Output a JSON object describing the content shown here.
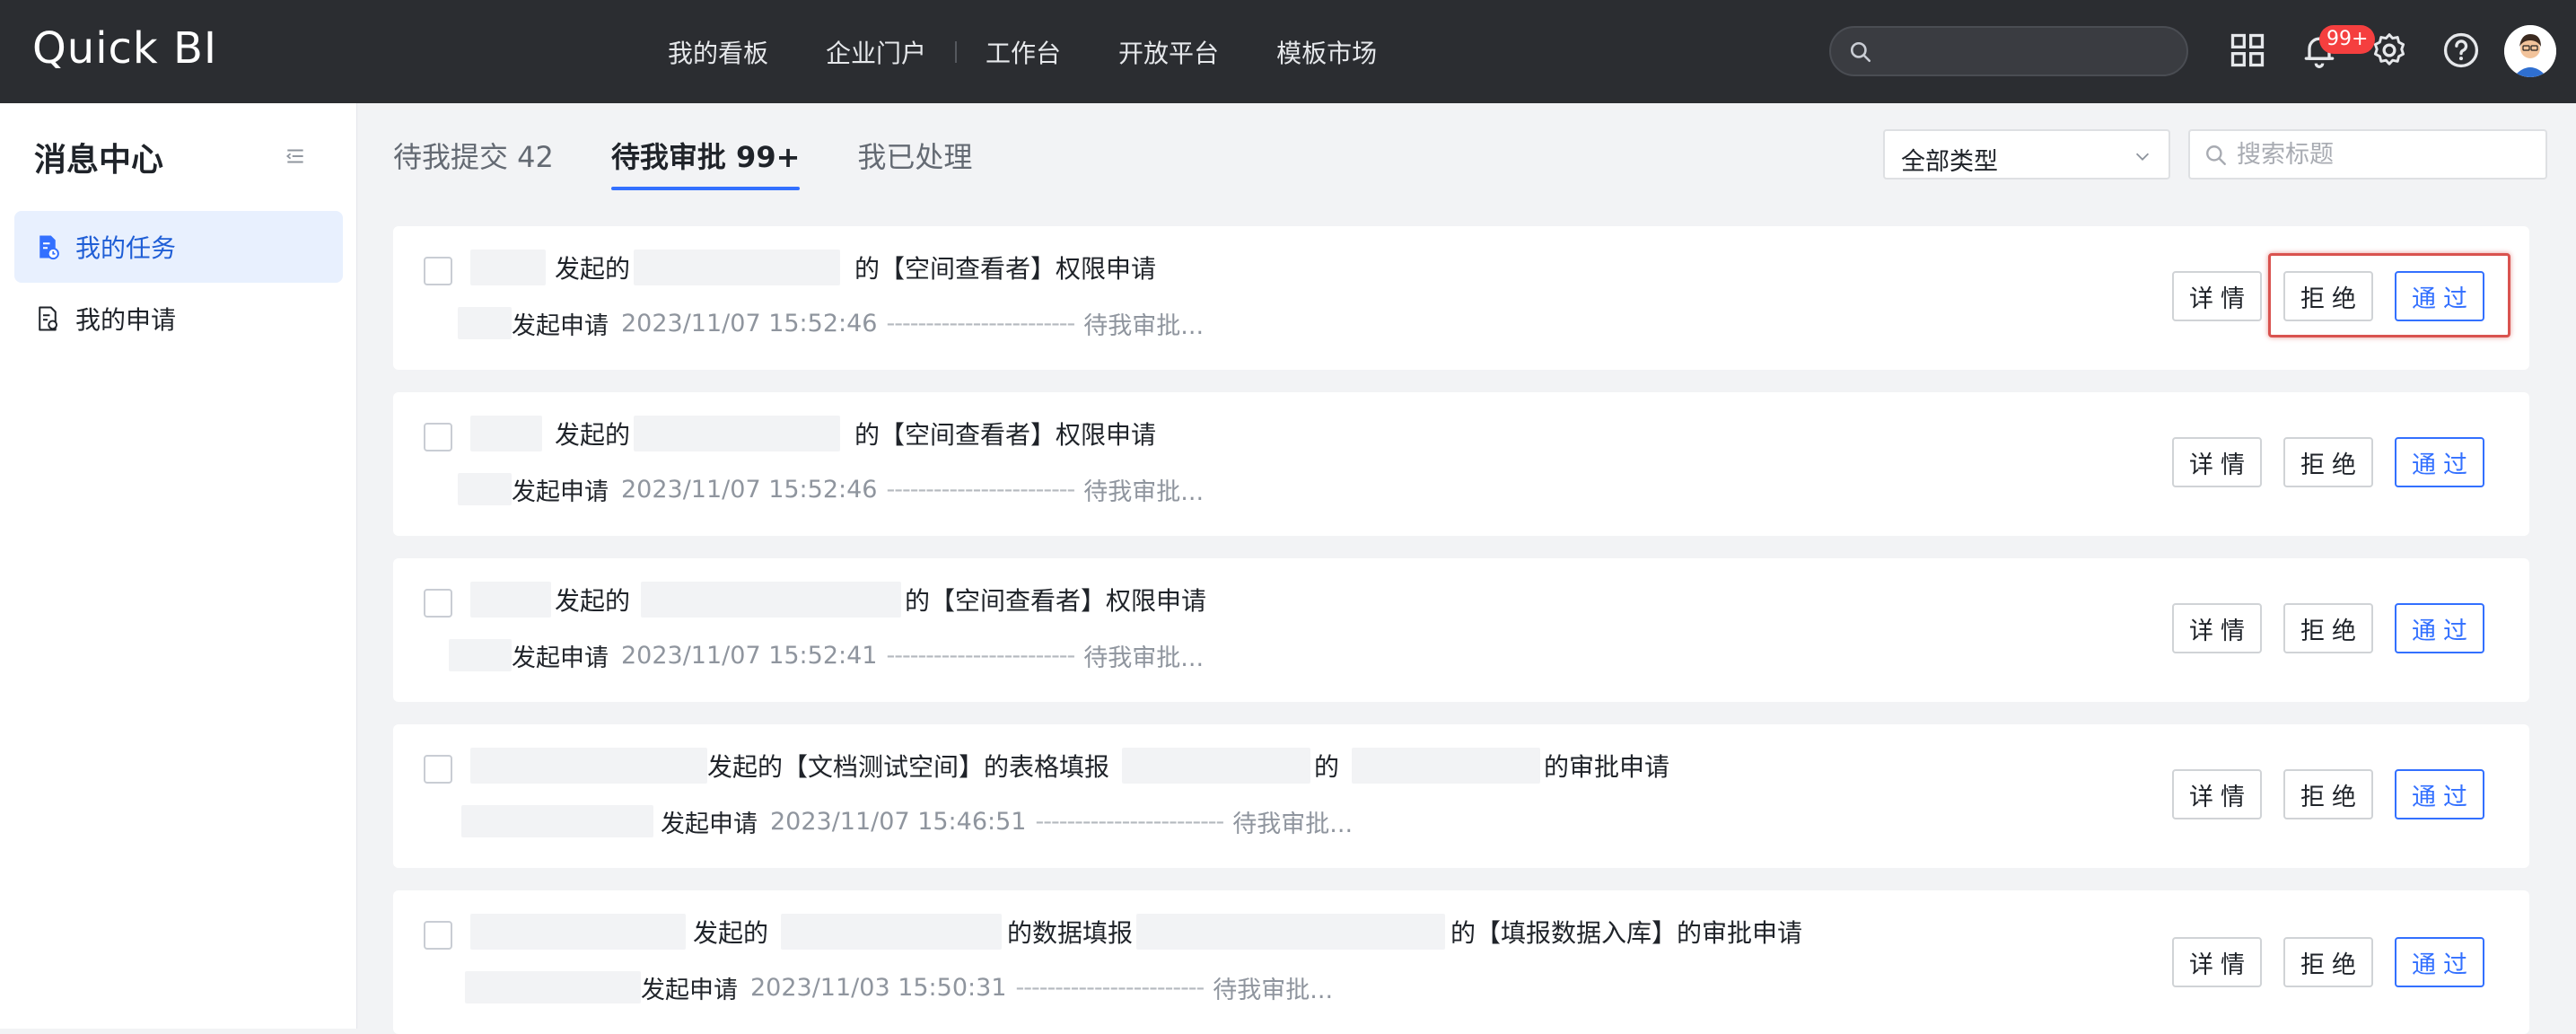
{
  "app": {
    "logo": "Quick BI"
  },
  "nav": {
    "items": [
      "我的看板",
      "企业门户",
      "工作台",
      "开放平台",
      "模板市场"
    ]
  },
  "header": {
    "notification_badge": "99+"
  },
  "sidebar": {
    "title": "消息中心",
    "items": [
      {
        "label": "我的任务",
        "active": true
      },
      {
        "label": "我的申请",
        "active": false
      }
    ]
  },
  "tabs": [
    {
      "label": "待我提交 42",
      "active": false
    },
    {
      "label": "待我审批 99+",
      "active": true
    },
    {
      "label": "我已处理",
      "active": false
    }
  ],
  "filters": {
    "type_select": "全部类型",
    "search_placeholder": "搜索标题"
  },
  "buttons": {
    "details": "详情",
    "reject": "拒绝",
    "approve": "通过"
  },
  "cards": [
    {
      "title_parts": [
        "发起的",
        "的【空间查看者】权限申请"
      ],
      "apply_label": "发起申请",
      "time": "2023/11/07 15:52:46",
      "dashes": "------------------------",
      "status": "待我审批..."
    },
    {
      "title_parts": [
        "发起的",
        "的【空间查看者】权限申请"
      ],
      "apply_label": "发起申请",
      "time": "2023/11/07 15:52:46",
      "dashes": "------------------------",
      "status": "待我审批..."
    },
    {
      "title_parts": [
        "发起的",
        "的【空间查看者】权限申请"
      ],
      "apply_label": "发起申请",
      "time": "2023/11/07 15:52:41",
      "dashes": "------------------------",
      "status": "待我审批..."
    },
    {
      "title_parts": [
        "发起的【文档测试空间】的表格填报",
        "的",
        "的审批申请"
      ],
      "apply_label": "发起申请",
      "time": "2023/11/07 15:46:51",
      "dashes": "------------------------",
      "status": "待我审批..."
    },
    {
      "title_parts": [
        "发起的",
        "的数据填报",
        "的【填报数据入库】的审批申请"
      ],
      "apply_label": "发起申请",
      "time": "2023/11/03 15:50:31",
      "dashes": "------------------------",
      "status": "待我审批..."
    }
  ],
  "colors": {
    "topbar": "#2b2d31",
    "accent": "#3370ff",
    "badge": "#f53f3f",
    "highlight": "#d9534f"
  }
}
